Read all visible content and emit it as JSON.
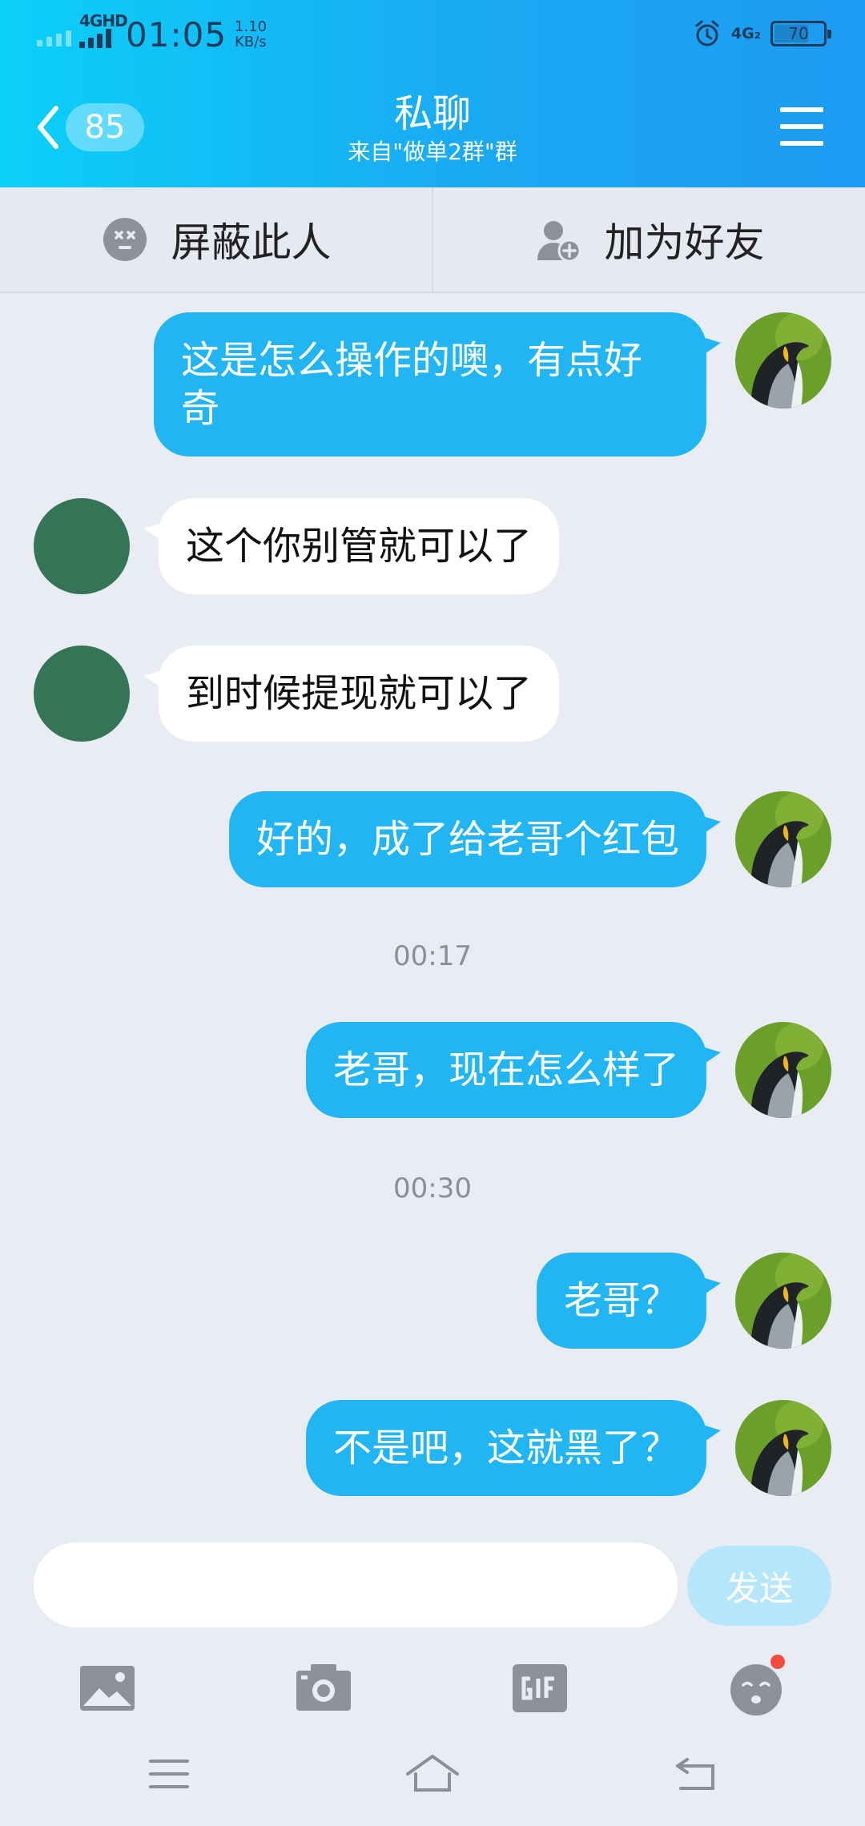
{
  "status_bar": {
    "network": "4GHD",
    "time": "01:05",
    "speed_value": "1.10",
    "speed_unit": "KB/s",
    "network2": "4G₂",
    "battery": "70"
  },
  "header": {
    "unread_count": "85",
    "title": "私聊",
    "subtitle": "来自\"做单2群\"群",
    "accent": "#1aa9f3"
  },
  "actions": {
    "block_label": "屏蔽此人",
    "add_friend_label": "加为好友"
  },
  "messages": [
    {
      "side": "self",
      "text": "这是怎么操作的噢，有点好\n奇"
    },
    {
      "side": "other",
      "text": "这个你别管就可以了"
    },
    {
      "side": "other",
      "text": "到时候提现就可以了"
    },
    {
      "side": "self",
      "text": "好的，成了给老哥个红包"
    },
    {
      "side": "self",
      "text": "老哥，现在怎么样了"
    },
    {
      "side": "self",
      "text": "老哥？"
    },
    {
      "side": "self",
      "text": "不是吧，这就黑了？"
    }
  ],
  "timestamps": [
    "00:17",
    "00:30"
  ],
  "input": {
    "value": "",
    "placeholder": "",
    "send_label": "发送"
  },
  "toolbar": [
    "image-icon",
    "camera-icon",
    "gif-icon",
    "emoji-icon"
  ],
  "system_nav": [
    "menu-icon",
    "home-icon",
    "back-icon"
  ],
  "colors": {
    "self_bubble": "#22b5f4",
    "other_bubble": "#ffffff",
    "background": "#e9ecf3",
    "other_avatar": "#347556"
  }
}
